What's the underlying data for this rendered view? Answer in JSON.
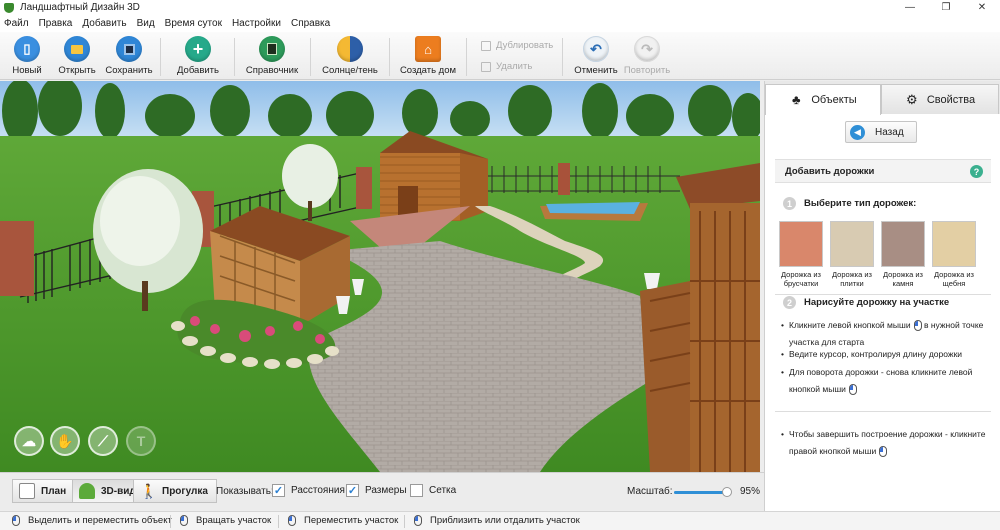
{
  "window": {
    "title": "Ландшафтный Дизайн 3D",
    "controls": [
      "—",
      "❐",
      "✕"
    ]
  },
  "menu": [
    "Файл",
    "Правка",
    "Добавить",
    "Вид",
    "Время суток",
    "Настройки",
    "Справка"
  ],
  "toolbar": {
    "new": "Новый",
    "open": "Открыть",
    "save": "Сохранить",
    "add": "Добавить",
    "reference": "Справочник",
    "sun_shadow": "Солнце/тень",
    "create_house": "Создать дом",
    "duplicate": "Дублировать",
    "delete": "Удалить",
    "undo": "Отменить",
    "redo": "Повторить"
  },
  "panel": {
    "tab_objects": "Объекты",
    "tab_properties": "Свойства",
    "back": "Назад",
    "section_title": "Добавить дорожки",
    "help": "?",
    "step1_num": "1",
    "step1": "Выберите тип дорожек:",
    "path_types": [
      {
        "label": "Дорожка из брусчатки",
        "color": "#d9876b"
      },
      {
        "label": "Дорожка из плитки",
        "color": "#d8cbb2"
      },
      {
        "label": "Дорожка из камня",
        "color": "#a88e84"
      },
      {
        "label": "Дорожка из щебня",
        "color": "#e3cfa4"
      }
    ],
    "step2_num": "2",
    "step2": "Нарисуйте дорожку на участке",
    "bullets": [
      "Кликните левой кнопкой мыши",
      "в нужной точке участка для старта",
      "Ведите курсор, контролируя длину дорожки",
      "Для поворота дорожки - снова кликните левой кнопкой мыши",
      "Чтобы завершить построение дорожки - кликните правой кнопкой мыши"
    ]
  },
  "bottom": {
    "view_plan": "План",
    "view_3d": "3D-вид",
    "view_walk": "Прогулка",
    "show_label": "Показывать:",
    "distances": {
      "label": "Расстояния",
      "checked": true
    },
    "sizes": {
      "label": "Размеры",
      "checked": true
    },
    "grid": {
      "label": "Сетка",
      "checked": false
    },
    "scale_label": "Масштаб:",
    "scale_value": "95%",
    "scale_fraction": 0.95
  },
  "status": [
    "Выделить и переместить объект",
    "Вращать участок",
    "Переместить участок",
    "Приблизить или отдалить участок"
  ]
}
